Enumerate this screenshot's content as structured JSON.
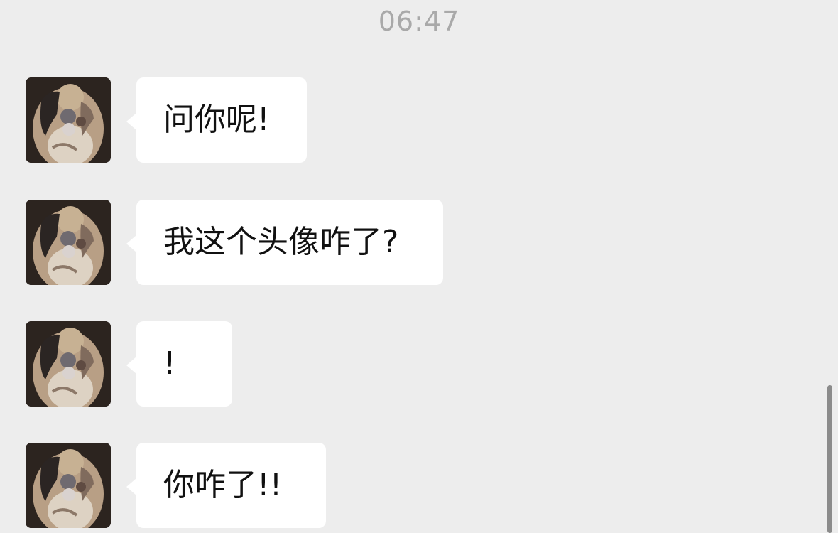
{
  "chat": {
    "timestamp": "06:47",
    "messages": [
      {
        "sender": "other",
        "avatar_icon": "user-avatar-icon",
        "text": "问你呢!"
      },
      {
        "sender": "other",
        "avatar_icon": "user-avatar-icon",
        "text": "我这个头像咋了?"
      },
      {
        "sender": "other",
        "avatar_icon": "user-avatar-icon",
        "text": "!"
      },
      {
        "sender": "other",
        "avatar_icon": "user-avatar-icon",
        "text": "你咋了!!"
      }
    ]
  },
  "colors": {
    "background": "#ededed",
    "bubble": "#ffffff",
    "timestamp": "#a9a9a9",
    "text": "#111111",
    "scrollbar": "#8b8b8b"
  }
}
